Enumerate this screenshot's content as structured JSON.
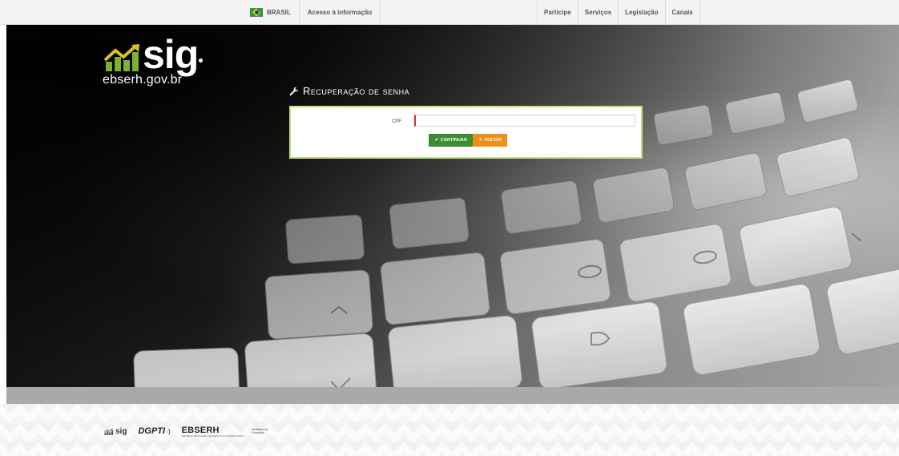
{
  "govbar": {
    "brasil_label": "BRASIL",
    "access_label": "Acesso à informação",
    "links": [
      "Participe",
      "Serviços",
      "Legislação",
      "Canais"
    ]
  },
  "logo": {
    "sig": "sig",
    "domain": "ebserh.gov.br",
    "icon": "growth-chart-icon"
  },
  "panel": {
    "title": "Recuperação de senha",
    "title_icon": "wrench-icon",
    "cpf_label": "CPF",
    "cpf_value": "",
    "continue_label": "CONTINUAR",
    "continue_icon": "check-icon",
    "back_label": "VOLTAR",
    "back_icon": "back-arrow-icon"
  },
  "footer": {
    "sig": "sig",
    "dgpti": "DGPTI",
    "ebserh": "EBSERH",
    "ebserh_tagline": "EMPRESA BRASILEIRA DE SERVIÇOS HOSPITALARES",
    "ministerio": [
      "Ministério da",
      "Educação"
    ]
  },
  "colors": {
    "green_button": "#3c8d2f",
    "orange_button": "#ef8f1a",
    "panel_border": "#bfe27a",
    "logo_green": "#7bb32e",
    "logo_yellow": "#d9c21c"
  }
}
